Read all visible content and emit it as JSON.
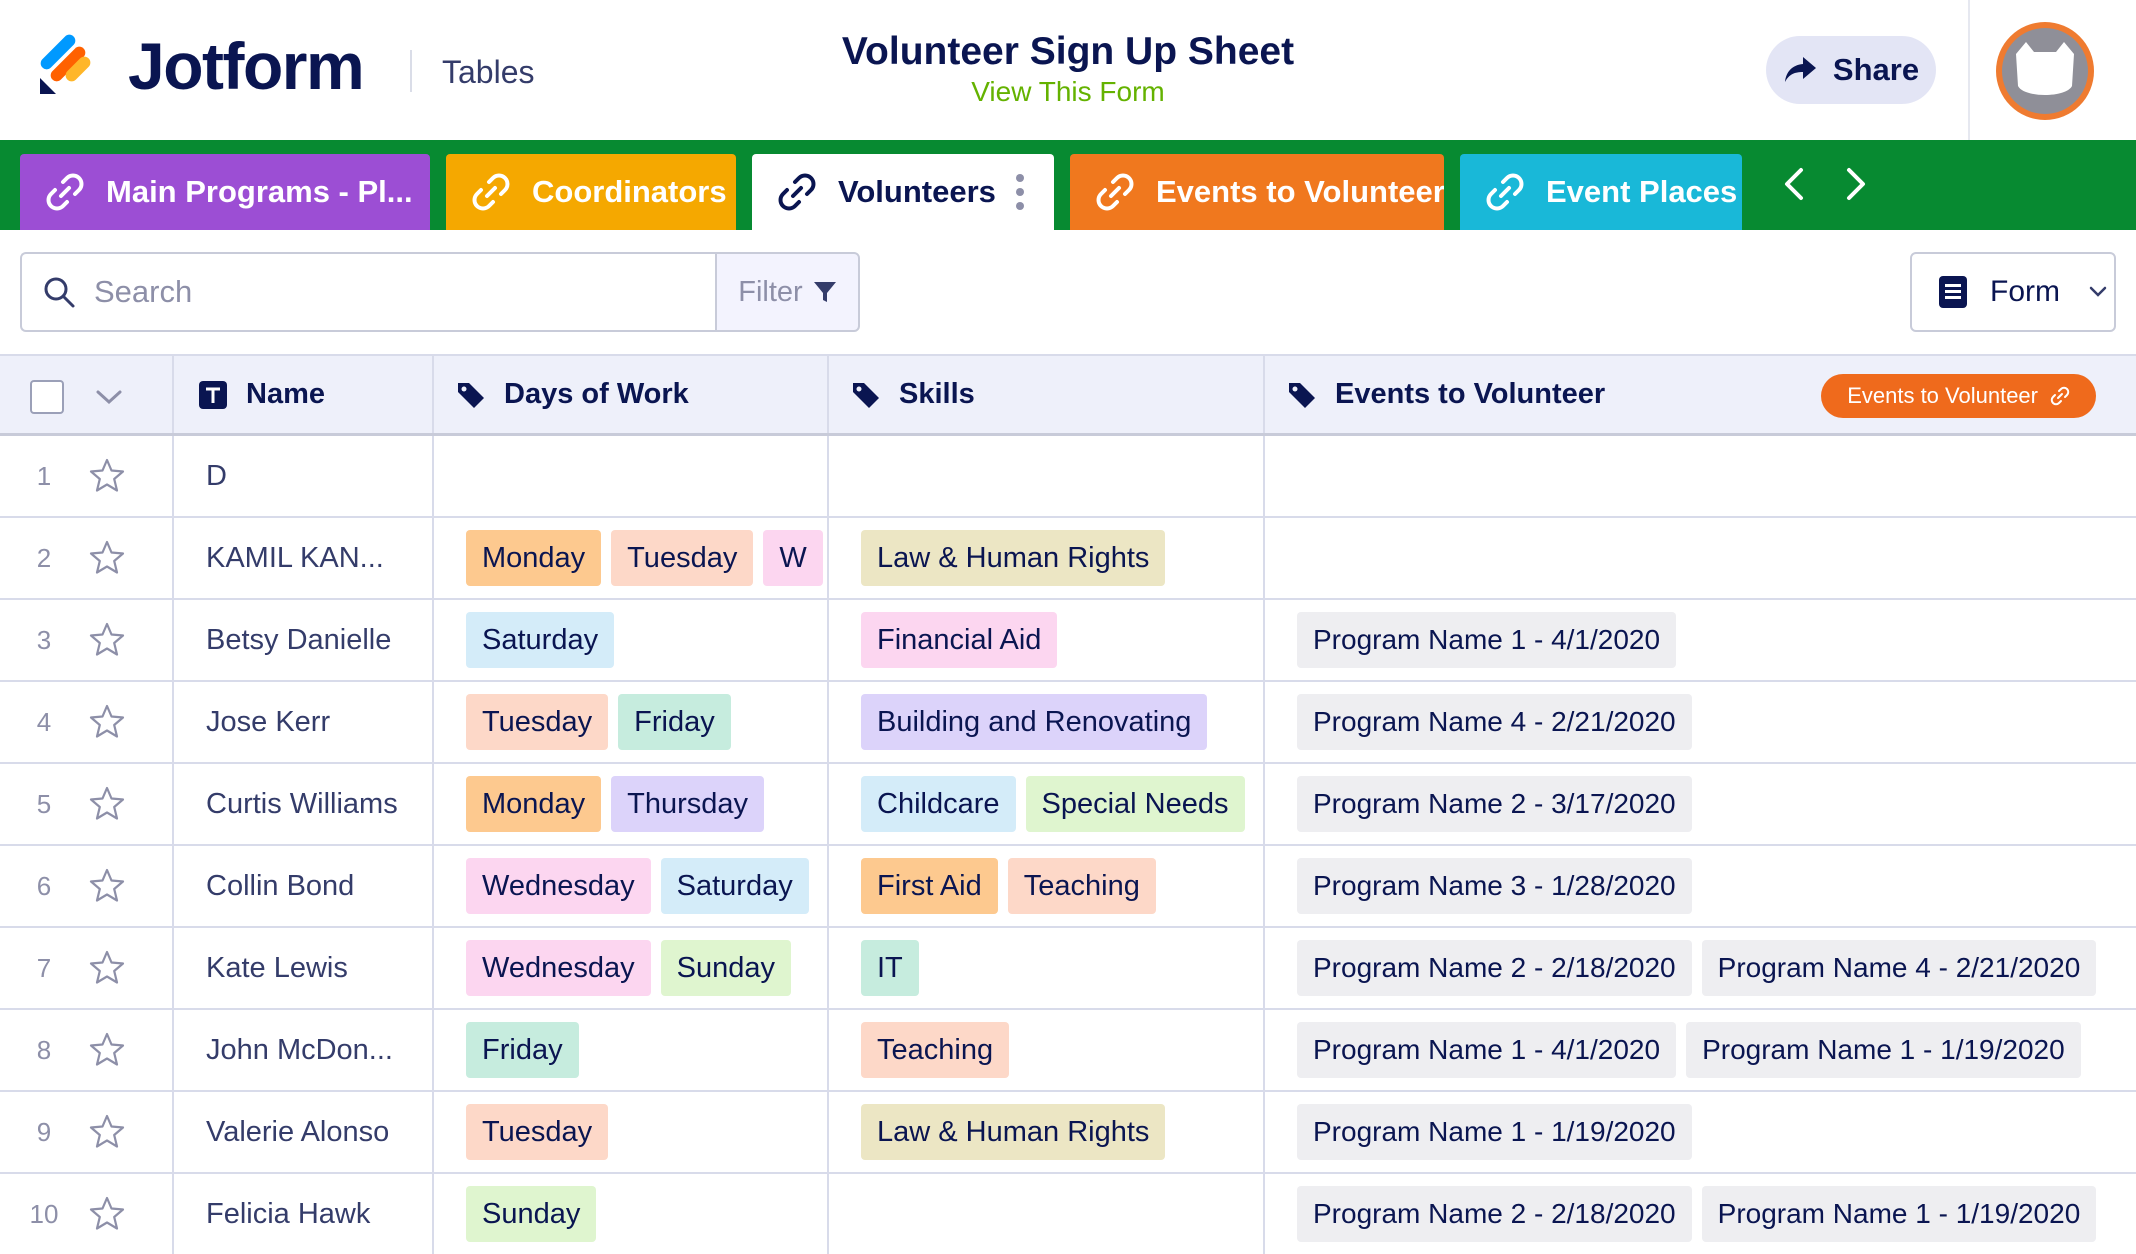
{
  "header": {
    "logo_text": "Jotform",
    "section_label": "Tables",
    "title": "Volunteer Sign Up Sheet",
    "subtitle_link": "View This Form",
    "share_label": "Share"
  },
  "tabs": [
    {
      "label": "Main Programs - Pl...",
      "color": "#9c4ed4",
      "active": false
    },
    {
      "label": "Coordinators",
      "color": "#f5a800",
      "active": false
    },
    {
      "label": "Volunteers",
      "color": "#ffffff",
      "active": true
    },
    {
      "label": "Events to Volunteer",
      "color": "#f0781e",
      "active": false
    },
    {
      "label": "Event Places",
      "color": "#19b8d8",
      "active": false
    }
  ],
  "toolbar": {
    "search_placeholder": "Search",
    "filter_label": "Filter",
    "view_label": "Form"
  },
  "table": {
    "columns": [
      {
        "label": "Name",
        "icon": "text-field-icon"
      },
      {
        "label": "Days of Work",
        "icon": "tag-icon"
      },
      {
        "label": "Skills",
        "icon": "tag-icon"
      },
      {
        "label": "Events to Volunteer",
        "icon": "tag-icon",
        "link_badge": "Events to Volunteer"
      }
    ],
    "rows": [
      {
        "num": "1",
        "name": "D",
        "days": [],
        "skills": [],
        "events": []
      },
      {
        "num": "2",
        "name": "KAMIL KAN...",
        "days": [
          "Monday",
          "Tuesday",
          "W"
        ],
        "skills": [
          "Law & Human Rights"
        ],
        "events": []
      },
      {
        "num": "3",
        "name": "Betsy Danielle",
        "days": [
          "Saturday"
        ],
        "skills": [
          "Financial Aid"
        ],
        "events": [
          "Program Name 1 - 4/1/2020"
        ]
      },
      {
        "num": "4",
        "name": "Jose Kerr",
        "days": [
          "Tuesday",
          "Friday"
        ],
        "skills": [
          "Building and Renovating"
        ],
        "events": [
          "Program Name 4 - 2/21/2020"
        ]
      },
      {
        "num": "5",
        "name": "Curtis Williams",
        "days": [
          "Monday",
          "Thursday"
        ],
        "skills": [
          "Childcare",
          "Special Needs"
        ],
        "events": [
          "Program Name 2 - 3/17/2020"
        ]
      },
      {
        "num": "6",
        "name": "Collin Bond",
        "days": [
          "Wednesday",
          "Saturday"
        ],
        "skills": [
          "First Aid",
          "Teaching"
        ],
        "events": [
          "Program Name 3 - 1/28/2020"
        ]
      },
      {
        "num": "7",
        "name": "Kate Lewis",
        "days": [
          "Wednesday",
          "Sunday"
        ],
        "skills": [
          "IT"
        ],
        "events": [
          "Program Name 2 - 2/18/2020",
          "Program Name 4 - 2/21/2020"
        ]
      },
      {
        "num": "8",
        "name": "John McDon...",
        "days": [
          "Friday"
        ],
        "skills": [
          "Teaching"
        ],
        "events": [
          "Program Name 1 - 4/1/2020",
          "Program Name 1 - 1/19/2020"
        ]
      },
      {
        "num": "9",
        "name": "Valerie Alonso",
        "days": [
          "Tuesday"
        ],
        "skills": [
          "Law & Human Rights"
        ],
        "events": [
          "Program Name 1 - 1/19/2020"
        ]
      },
      {
        "num": "10",
        "name": "Felicia Hawk",
        "days": [
          "Sunday"
        ],
        "skills": [],
        "events": [
          "Program Name 2 - 2/18/2020",
          "Program Name 1 - 1/19/2020"
        ]
      }
    ]
  },
  "tag_colors": {
    "Monday": "#fdc98f",
    "Tuesday": "#fdd8c8",
    "W": "#fcd6f0",
    "Wednesday": "#fcd6f0",
    "Thursday": "#dcd3fa",
    "Friday": "#c6ecde",
    "Saturday": "#d4ecf9",
    "Sunday": "#dff5cf",
    "Law & Human Rights": "#ece6c4",
    "Financial Aid": "#fcd6f0",
    "Building and Renovating": "#dcd3fa",
    "Childcare": "#d4ecf9",
    "Special Needs": "#dff5cf",
    "First Aid": "#fdc98f",
    "Teaching": "#fdd8c8",
    "IT": "#c6ecde"
  },
  "colors": {
    "brand_navy": "#0a1551",
    "tab_bar_green": "#078a31",
    "link_green": "#64b200",
    "badge_orange": "#ef6a1c"
  }
}
